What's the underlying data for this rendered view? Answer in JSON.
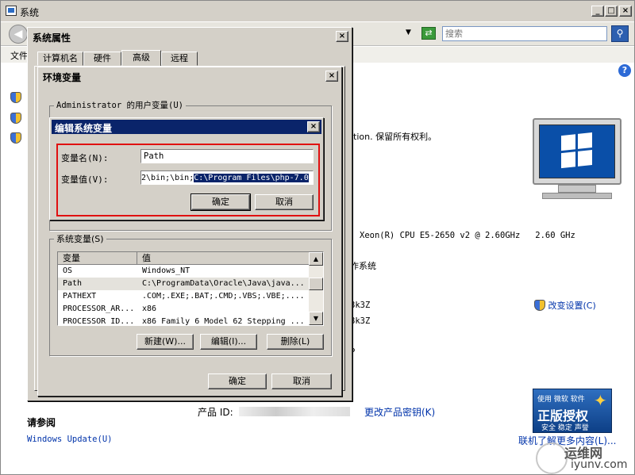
{
  "main_window": {
    "title": "系统",
    "search_placeholder": "搜索",
    "menu_file": "文件",
    "copyright": "tion. 保留所有权利。",
    "cpu": "Xeon(R) CPU E5-2650 v2 @ 2.60GHz   2.60 GHz",
    "os_type": "作系统",
    "comp1": "8k3Z",
    "comp2": "8k3Z",
    "comp3": "P",
    "change_settings": "改变设置(C)",
    "product_id_label": "产品 ID:",
    "change_key": "更改产品密钥(K)",
    "see_also": "请参阅",
    "windows_update": "Windows Update(U)",
    "learn_more": "联机了解更多内容(L)...",
    "genuine_top": "使用 微软 软件",
    "genuine_main": "正版授权",
    "genuine_sub": "安全 稳定 声誉",
    "watermark_cn": "运维网",
    "watermark_url": "iyunv.com"
  },
  "sysprops": {
    "title": "系统属性",
    "tabs": [
      "计算机名",
      "硬件",
      "高级",
      "远程"
    ],
    "ok": "确定",
    "cancel": "取消"
  },
  "envvars": {
    "title": "环境变量",
    "user_group": "Administrator 的用户变量(U)",
    "system_group": "系统变量(S)",
    "columns": [
      "变量",
      "值"
    ],
    "rows": [
      {
        "name": "OS",
        "value": "Windows_NT"
      },
      {
        "name": "Path",
        "value": "C:\\ProgramData\\Oracle\\Java\\java..."
      },
      {
        "name": "PATHEXT",
        "value": ".COM;.EXE;.BAT;.CMD;.VBS;.VBE;...."
      },
      {
        "name": "PROCESSOR_AR...",
        "value": "x86"
      },
      {
        "name": "PROCESSOR_ID...",
        "value": "x86 Family 6 Model 62 Stepping ..."
      }
    ],
    "new_btn": "新建(W)...",
    "edit_btn": "编辑(I)...",
    "delete_btn": "删除(L)",
    "ok": "确定",
    "cancel": "取消"
  },
  "editvar": {
    "title": "编辑系统变量",
    "name_label": "变量名(N):",
    "name_value": "Path",
    "value_label": "变量值(V):",
    "value_plain": "2\\bin;\\bin;",
    "value_selected": "C:\\Program Files\\php-7.0",
    "ok": "确定",
    "cancel": "取消"
  },
  "colors": {
    "selection": "#0a246a",
    "highlight_border": "#e01010",
    "titlebar": "#0a246a"
  }
}
